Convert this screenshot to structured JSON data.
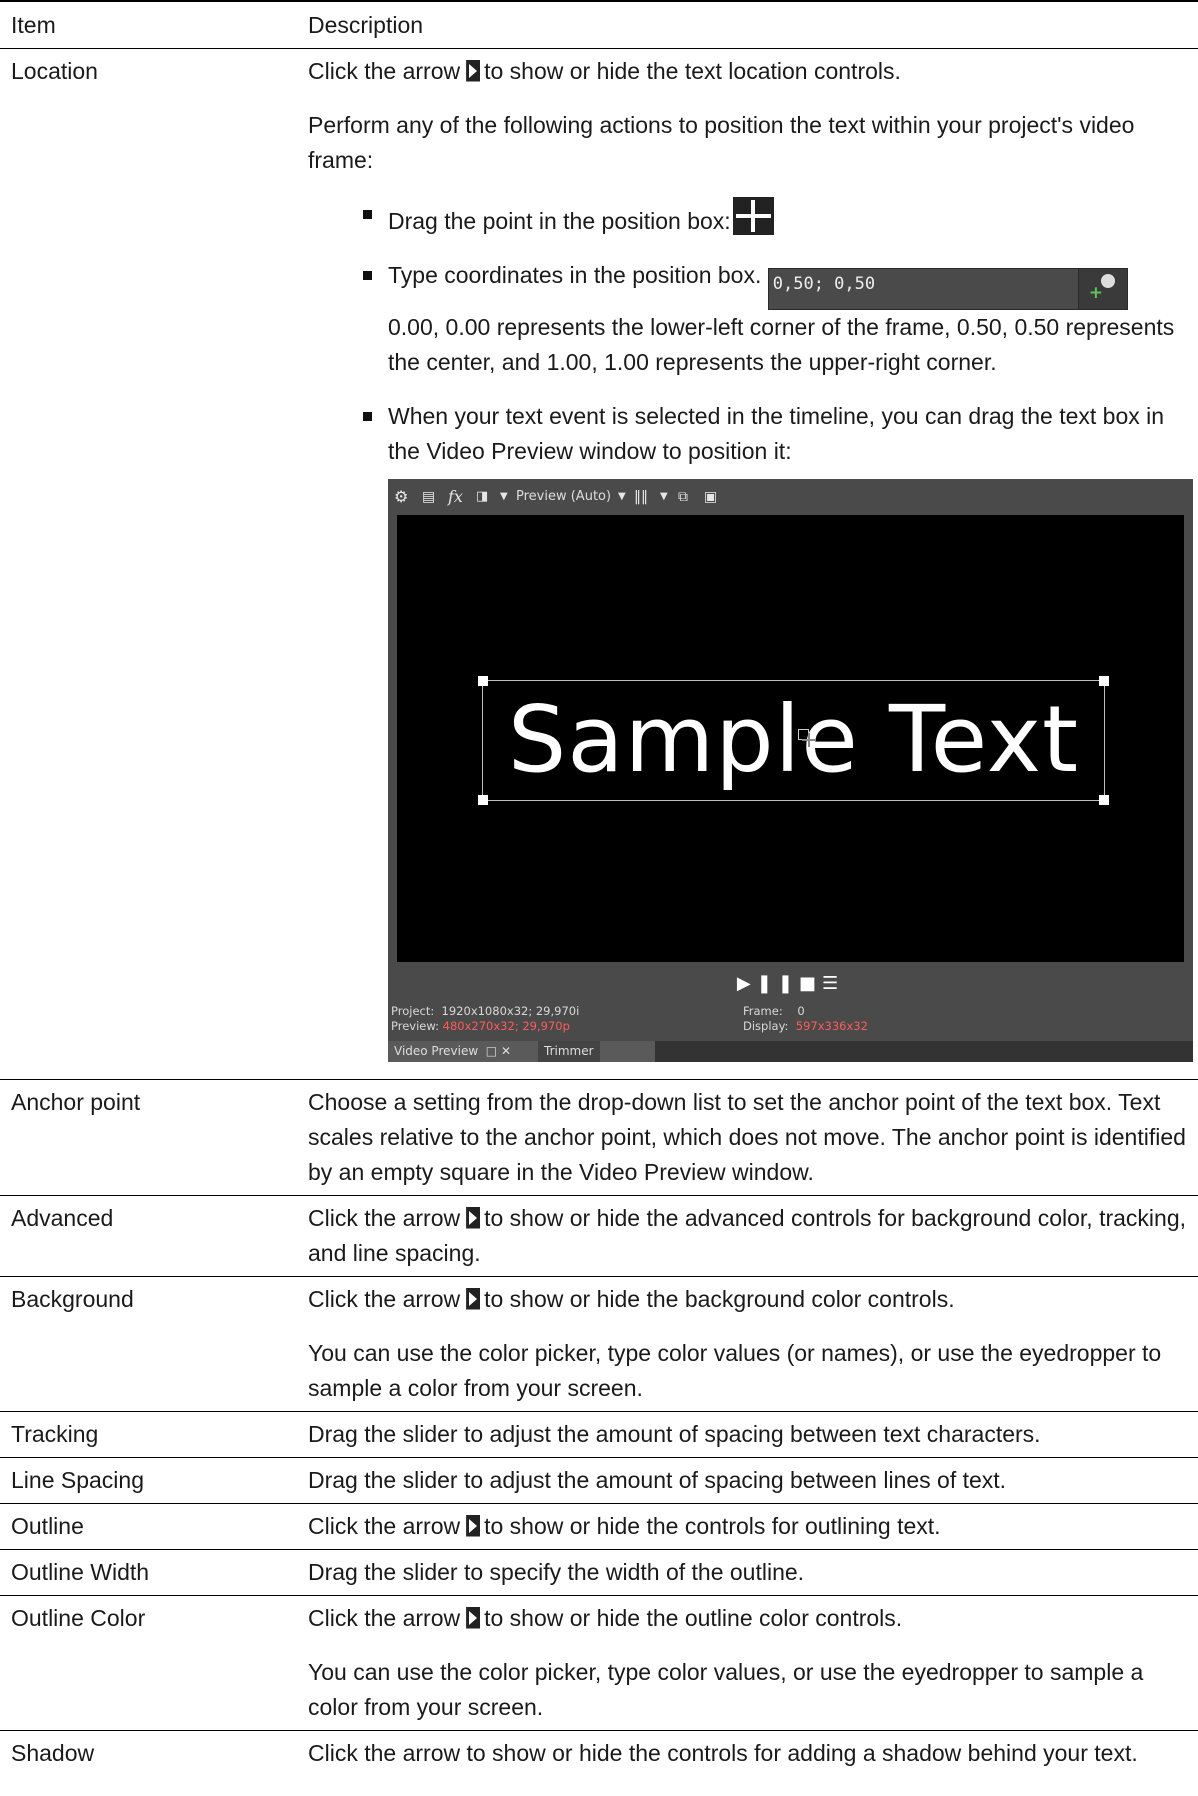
{
  "headers": {
    "item": "Item",
    "description": "Description"
  },
  "rows": [
    {
      "item": "Location",
      "p1_before": "Click the arrow",
      "p1_after": "to show or hide the text location controls.",
      "p2": "Perform any of the following actions to position the text within your project's video frame:",
      "bullet1": "Drag the point in the position box:",
      "bullet2_before": "Type coordinates in the position box.",
      "bullet2_after": "0.00, 0.00 represents the lower-left corner of the frame, 0.50, 0.50 represents the center, and 1.00, 1.00 represents the upper-right corner.",
      "coord_value": "0,50; 0,50",
      "bullet3": "When your text event is selected in the timeline, you can drag the text box in the Video Preview window to position it:"
    },
    {
      "item": "Anchor point",
      "p1": "Choose a setting from the drop-down list to set the anchor point of the text box. Text scales relative to the anchor point, which does not move. The anchor point is identified by an empty square in the Video Preview window."
    },
    {
      "item": "Advanced",
      "p1_before": "Click the arrow",
      "p1_after": "to show or hide the advanced controls for background color, tracking, and line spacing."
    },
    {
      "item": "Background",
      "p1_before": "Click the arrow",
      "p1_after": "to show or hide the background color controls.",
      "p2": "You can use the color picker, type color values (or names), or use the eyedropper to sample a color from your screen."
    },
    {
      "item": "Tracking",
      "p1": "Drag the slider to adjust the amount of spacing between text characters."
    },
    {
      "item": "Line Spacing",
      "p1": "Drag the slider to adjust the amount of spacing between lines of text."
    },
    {
      "item": "Outline",
      "p1_before": "Click the arrow",
      "p1_after": "to show or hide the controls for outlining text."
    },
    {
      "item": "Outline Width",
      "p1": "Drag the slider to specify the width of the outline."
    },
    {
      "item": "Outline Color",
      "p1_before": "Click the arrow",
      "p1_after": "to show or hide the outline color controls.",
      "p2": "You can use the color picker, type color values, or use the eyedropper to sample a color from your screen."
    },
    {
      "item": "Shadow",
      "p1": "Click the arrow to show or hide the controls for adding a shadow behind your text."
    }
  ],
  "video_preview": {
    "toolbar_label": "Preview (Auto)",
    "sample_text": "Sample Text",
    "project_label": "Project:",
    "project_value": "1920x1080x32; 29,970i",
    "preview_label": "Preview:",
    "preview_value": "480x270x32; 29,970p",
    "frame_label": "Frame:",
    "frame_value": "0",
    "display_label": "Display:",
    "display_value": "597x336x32",
    "tab_video_preview": "Video Preview",
    "tab_trimmer": "Trimmer"
  }
}
